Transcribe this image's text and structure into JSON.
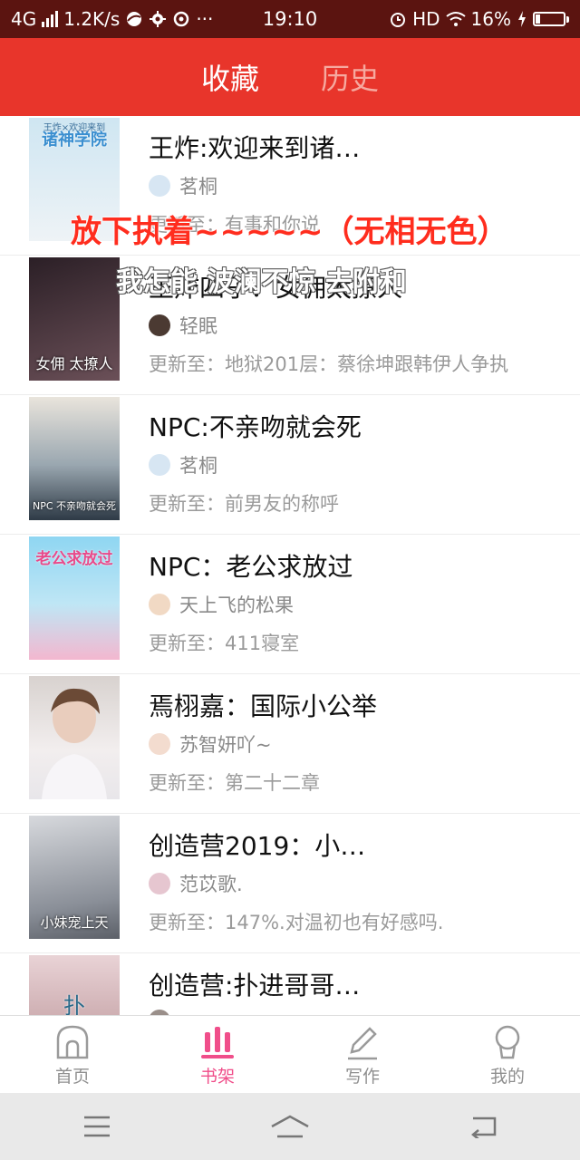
{
  "status_bar": {
    "network": "4G",
    "speed": "1.2K/s",
    "time": "19:10",
    "hd": "HD",
    "battery": "16%",
    "icons": [
      "signal-icon",
      "browser-icon",
      "gear-icon",
      "weibo-icon",
      "more-icon",
      "alarm-icon",
      "wifi-icon",
      "battery-icon",
      "charging-icon"
    ]
  },
  "header": {
    "tabs": [
      {
        "label": "收藏",
        "active": true
      },
      {
        "label": "历史",
        "active": false
      }
    ]
  },
  "books": [
    {
      "title": "王炸:欢迎来到诸…",
      "author": "茗桐",
      "update": "更新至：有事和你说",
      "cover_title": "诸神学院",
      "cover_subtitle": "王炸×欢迎来到",
      "cover_colors": [
        "#cfe6f2",
        "#eef3f6"
      ]
    },
    {
      "title": "王炸四子：女佣太撩人",
      "author": "轻眠",
      "update": "更新至：地狱201层：蔡徐坤跟韩伊人争执",
      "cover_title": "",
      "cover_subtitle": "女佣 太撩人",
      "cover_colors": [
        "#2b1f26",
        "#6b5058"
      ]
    },
    {
      "title": "NPC:不亲吻就会死",
      "author": "茗桐",
      "update": "更新至：前男友的称呼",
      "cover_title": "",
      "cover_subtitle": "NPC 不亲吻就会死",
      "cover_colors": [
        "#e9e4dc",
        "#3a4a5a"
      ]
    },
    {
      "title": "NPC：老公求放过",
      "author": "天上飞的松果",
      "update": "更新至：411寝室",
      "cover_title": "老公求放过",
      "cover_subtitle": "",
      "cover_colors": [
        "#8fd6f2",
        "#f3b7cf"
      ]
    },
    {
      "title": "焉栩嘉：国际小公举",
      "author": "苏智妍吖~",
      "update": "更新至：第二十二章",
      "cover_title": "",
      "cover_subtitle": "",
      "cover_colors": [
        "#d8d2cf",
        "#f2eeee"
      ]
    },
    {
      "title": "创造营2019：小…",
      "author": "范苡歌.",
      "update": "更新至：147%.对温初也有好感吗.",
      "cover_title": "",
      "cover_subtitle": "小妹宠上天",
      "cover_colors": [
        "#8a8f98",
        "#d7d9dd"
      ]
    },
    {
      "title": "创造营:扑进哥哥…",
      "author": "",
      "update": "",
      "cover_title": "扑",
      "cover_subtitle": "",
      "cover_colors": [
        "#e9d3d6",
        "#b38a8e"
      ]
    }
  ],
  "overlays": {
    "line1": "放下执着~~~~~（无相无色）",
    "line2": "我怎能 波澜不惊 去附和"
  },
  "bottom_nav": {
    "items": [
      {
        "label": "首页",
        "icon": "home-icon",
        "active": false
      },
      {
        "label": "书架",
        "icon": "bookshelf-icon",
        "active": true
      },
      {
        "label": "写作",
        "icon": "pen-icon",
        "active": false
      },
      {
        "label": "我的",
        "icon": "profile-icon",
        "active": false
      }
    ]
  },
  "system_nav": {
    "icons": [
      "menu-icon",
      "home-icon",
      "back-icon"
    ]
  },
  "colors": {
    "status_bar": "#5b1410",
    "header": "#e8352b",
    "accent": "#f04e8a",
    "overlay_red": "#ff2d1e"
  }
}
